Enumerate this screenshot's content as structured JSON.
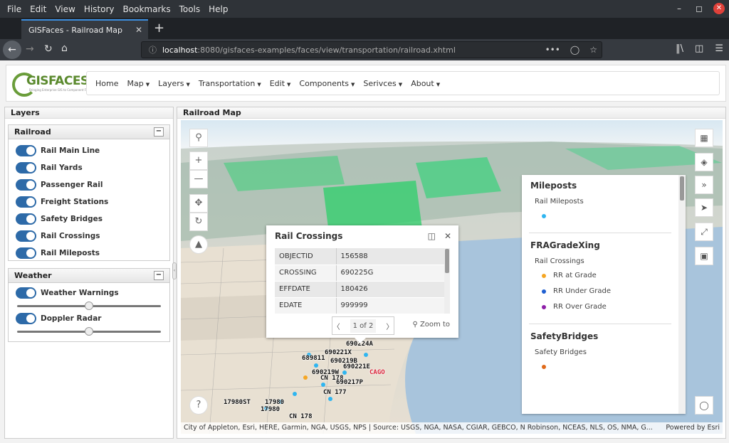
{
  "menubar": [
    "File",
    "Edit",
    "View",
    "History",
    "Bookmarks",
    "Tools",
    "Help"
  ],
  "tab": {
    "title": "GISFaces - Railroad Map"
  },
  "url": {
    "host": "localhost",
    "rest": ":8080/gisfaces-examples/faces/view/transportation/railroad.xhtml"
  },
  "logo": {
    "text": "GISFACES",
    "tagline": "Bringing Enterprise GIS to Component Faces"
  },
  "nav": [
    "Home",
    "Map",
    "Layers",
    "Transportation",
    "Edit",
    "Components",
    "Serivces",
    "About"
  ],
  "nav_dropdown": [
    false,
    true,
    true,
    true,
    true,
    true,
    true,
    true
  ],
  "layers_panel": {
    "title": "Layers",
    "railroad": {
      "title": "Railroad",
      "items": [
        "Rail Main Line",
        "Rail Yards",
        "Passenger Rail",
        "Freight Stations",
        "Safety Bridges",
        "Rail Crossings",
        "Rail Mileposts"
      ]
    },
    "weather": {
      "title": "Weather",
      "items": [
        "Weather Warnings",
        "Doppler Radar"
      ],
      "opacity": [
        0.5,
        0.5
      ]
    }
  },
  "map_panel": {
    "title": "Railroad Map"
  },
  "popup": {
    "title": "Rail Crossings",
    "rows": [
      [
        "OBJECTID",
        "156588"
      ],
      [
        "CROSSING",
        "690225G"
      ],
      [
        "EFFDATE",
        "180426"
      ],
      [
        "EDATE",
        "999999"
      ]
    ],
    "pager": "1 of 2",
    "zoom_label": "Zoom to"
  },
  "legend": {
    "groups": [
      {
        "title": "Mileposts",
        "subtitle": "Rail Mileposts",
        "items": [
          {
            "label": "",
            "color": "#2fb5f0"
          }
        ]
      },
      {
        "title": "FRAGradeXing",
        "subtitle": "Rail Crossings",
        "items": [
          {
            "label": "RR at Grade",
            "color": "#f5a623"
          },
          {
            "label": "RR Under Grade",
            "color": "#1f5fd1"
          },
          {
            "label": "RR Over Grade",
            "color": "#8e1fa8"
          }
        ]
      },
      {
        "title": "SafetyBridges",
        "subtitle": "Safety Bridges",
        "items": [
          {
            "label": "",
            "color": "#e06a1a"
          }
        ]
      }
    ]
  },
  "map_labels": [
    "690224A",
    "690221X",
    "689811",
    "690219B",
    "690221E",
    "690219W",
    "CN 178",
    "690217P",
    "CAGO",
    "CN 177",
    "17980",
    "17980ST",
    "17980",
    "CN 178"
  ],
  "attribution": {
    "text": "City of Appleton, Esri, HERE, Garmin, NGA, USGS, NPS | Source: USGS, NGA, NASA, CGIAR, GEBCO, N Robinson, NCEAS, NLS, OS, NMA, G...",
    "powered": "Powered by Esri"
  }
}
